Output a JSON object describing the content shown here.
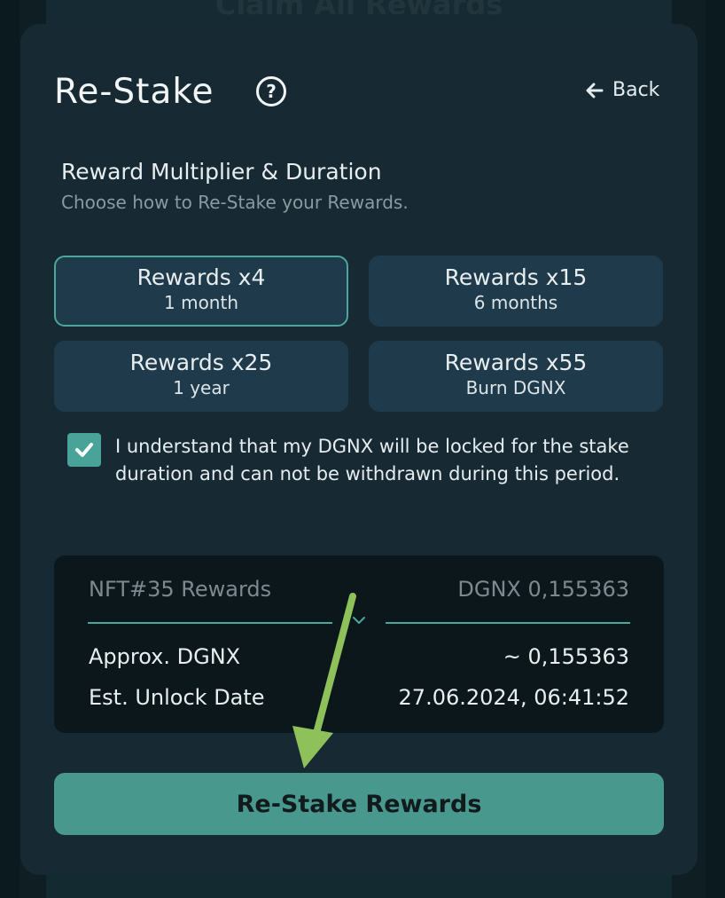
{
  "background": {
    "top_button_label": "Claim All Rewards"
  },
  "header": {
    "title": "Re-Stake",
    "help_icon": "question-circle-icon",
    "back_label": "Back",
    "back_icon": "arrow-left-icon"
  },
  "section": {
    "title": "Reward Multiplier & Duration",
    "subtitle": "Choose how to Re-Stake your Rewards."
  },
  "options": [
    {
      "label": "Rewards x4",
      "sublabel": "1 month",
      "selected": true
    },
    {
      "label": "Rewards x15",
      "sublabel": "6 months",
      "selected": false
    },
    {
      "label": "Rewards x25",
      "sublabel": "1 year",
      "selected": false
    },
    {
      "label": "Rewards x55",
      "sublabel": "Burn DGNX",
      "selected": false
    }
  ],
  "agreement": {
    "checked": true,
    "text": "I understand that my DGNX will be locked for the stake duration and can not be withdrawn during this period."
  },
  "summary": {
    "nft_label": "NFT#35 Rewards",
    "nft_value": "DGNX 0,155363",
    "rows": [
      {
        "label": "Approx. DGNX",
        "value": "~ 0,155363"
      },
      {
        "label": "Est. Unlock Date",
        "value": "27.06.2024, 06:41:52"
      }
    ]
  },
  "cta": {
    "label": "Re-Stake Rewards"
  },
  "colors": {
    "accent": "#48988e",
    "card_bg": "#172a34",
    "option_bg": "#1f3a4b",
    "annotation_arrow": "#8fc15a"
  }
}
